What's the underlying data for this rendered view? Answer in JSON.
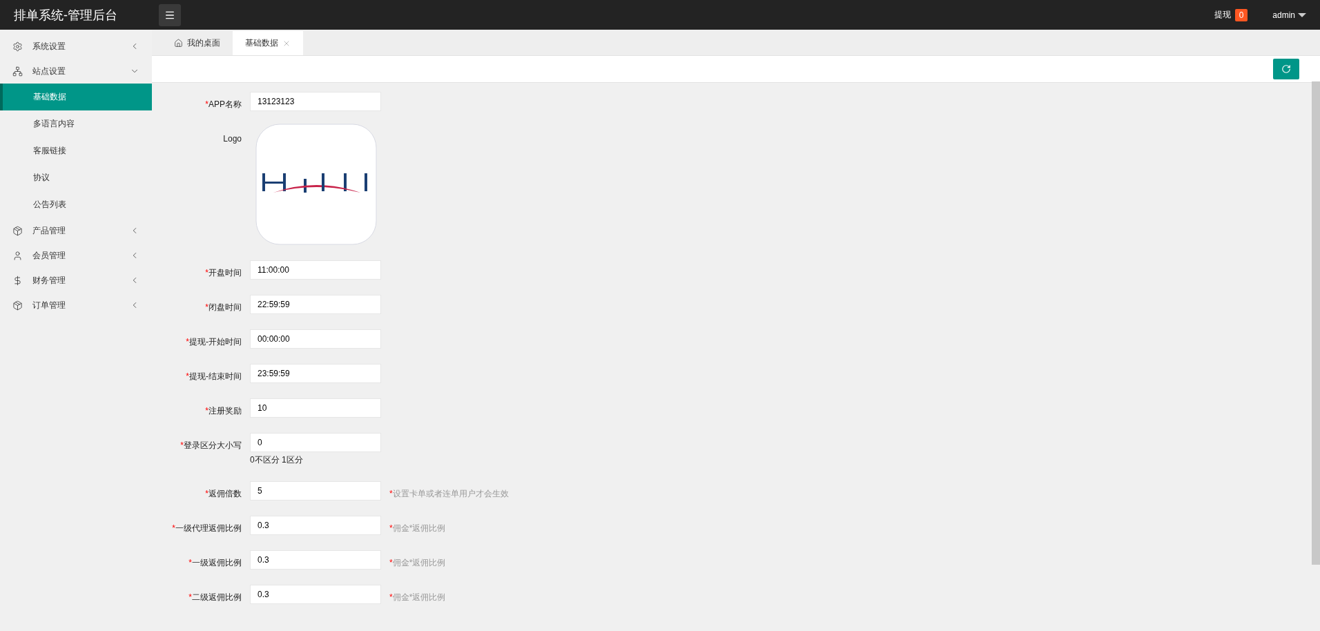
{
  "header": {
    "title": "排单系统-管理后台",
    "withdraw_label": "提现",
    "withdraw_count": "0",
    "user": "admin"
  },
  "sidebar": {
    "items": [
      {
        "label": "系统设置",
        "kind": "gear",
        "expanded": false
      },
      {
        "label": "站点设置",
        "kind": "network",
        "expanded": true,
        "children": [
          {
            "label": "基础数据",
            "selected": true
          },
          {
            "label": "多语言内容",
            "selected": false
          },
          {
            "label": "客服链接",
            "selected": false
          },
          {
            "label": "协议",
            "selected": false
          },
          {
            "label": "公告列表",
            "selected": false
          }
        ]
      },
      {
        "label": "产品管理",
        "kind": "box",
        "expanded": false
      },
      {
        "label": "会员管理",
        "kind": "user",
        "expanded": false
      },
      {
        "label": "财务管理",
        "kind": "dollar",
        "expanded": false
      },
      {
        "label": "订单管理",
        "kind": "box",
        "expanded": false
      }
    ]
  },
  "tabs": [
    {
      "label": "我的桌面",
      "kind": "home",
      "selected": false
    },
    {
      "label": "基础数据",
      "kind": "closable",
      "selected": true
    }
  ],
  "form": [
    {
      "kind": "text",
      "mark": "*",
      "label": "APP名称",
      "value": "13123123"
    },
    {
      "label": "Logo"
    },
    {
      "kind": "text",
      "mark": "*",
      "label": "开盘时间",
      "value": "11:00:00"
    },
    {
      "kind": "text",
      "mark": "*",
      "label": "闭盘时间",
      "value": "22:59:59"
    },
    {
      "kind": "text",
      "mark": "*",
      "label": "提现-开始时间",
      "value": "00:00:00"
    },
    {
      "kind": "text",
      "mark": "*",
      "label": "提现-结束时间",
      "value": "23:59:59"
    },
    {
      "kind": "text",
      "mark": "*",
      "label": "注册奖励",
      "value": "10"
    },
    {
      "kind": "text",
      "mark": "*",
      "label": "登录区分大小写",
      "value": "0",
      "note": "0不区分 1区分"
    },
    {
      "kind": "text",
      "mark": "*",
      "label": "返佣倍数",
      "value": "5",
      "hint_mark": "*",
      "hint": "设置卡单或者连单用户才会生效"
    },
    {
      "kind": "text",
      "mark": "*",
      "label": "一级代理返佣比例",
      "value": "0.3",
      "hint_mark": "*",
      "hint": "佣金*返佣比例"
    },
    {
      "kind": "text",
      "mark": "*",
      "label": "一级返佣比例",
      "value": "0.3",
      "hint_mark": "*",
      "hint": "佣金*返佣比例"
    },
    {
      "kind": "text",
      "mark": "*",
      "label": "二级返佣比例",
      "value": "0.3",
      "hint_mark": "*",
      "hint": "佣金*返佣比例"
    }
  ]
}
